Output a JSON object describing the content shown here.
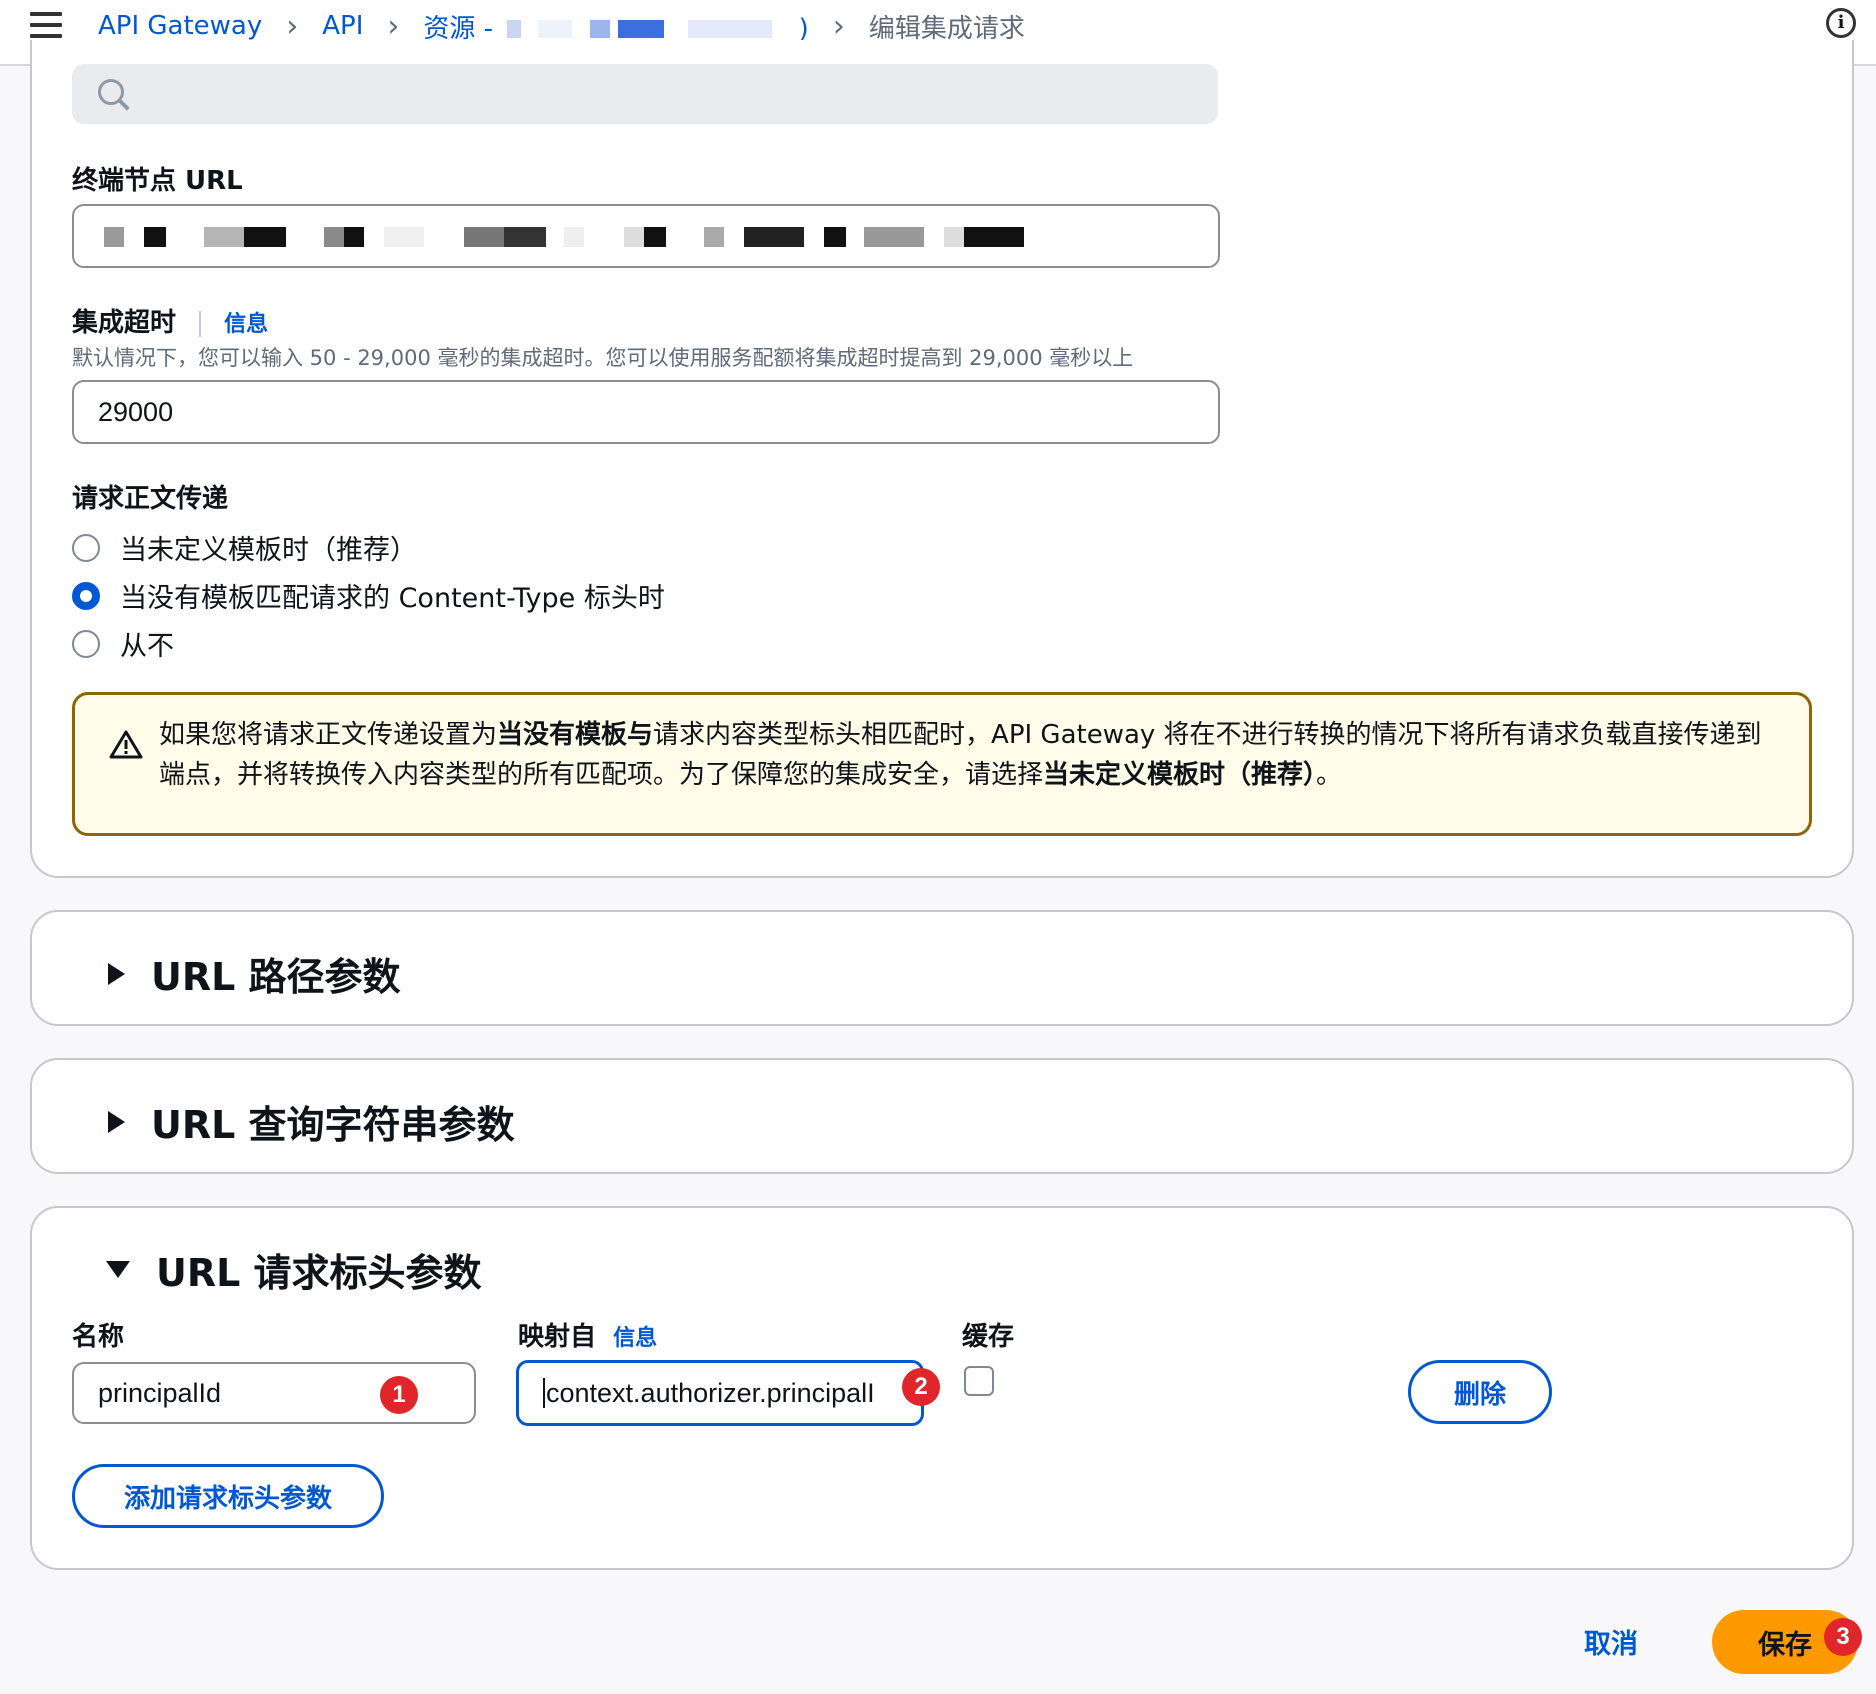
{
  "breadcrumbs": {
    "item1": "API Gateway",
    "item2": "API",
    "item3": "资源 -",
    "item3_suffix": ")",
    "current": "编辑集成请求"
  },
  "endpoint": {
    "label": "终端节点 URL"
  },
  "timeout": {
    "label": "集成超时",
    "info": "信息",
    "description": "默认情况下，您可以输入 50 - 29,000 毫秒的集成超时。您可以使用服务配额将集成超时提高到 29,000 毫秒以上",
    "value": "29000"
  },
  "passthrough": {
    "label": "请求正文传递",
    "options": [
      {
        "label": "当未定义模板时（推荐）",
        "checked": false
      },
      {
        "label": "当没有模板匹配请求的 Content-Type 标头时",
        "checked": true
      },
      {
        "label": "从不",
        "checked": false
      }
    ]
  },
  "alert": {
    "part1": "如果您将请求正文传递设置为",
    "bold1": "当没有模板与",
    "part2": "请求内容类型标头相匹配时，API Gateway 将在不进行转换的情况下将所有请求负载直接传递到端点，并将转换传入内容类型的所有匹配项。为了保障您的集成安全，请选择",
    "bold2": "当未定义模板时（推荐）",
    "part3": "。"
  },
  "sections": {
    "path_params": "URL 路径参数",
    "query_params": "URL 查询字符串参数",
    "header_params": "URL 请求标头参数"
  },
  "header_table": {
    "name_label": "名称",
    "mapped_label": "映射自",
    "mapped_info": "信息",
    "cache_label": "缓存",
    "rows": [
      {
        "name": "principalId",
        "mapped": "context.authorizer.principalI",
        "cached": false
      }
    ],
    "delete_label": "删除",
    "add_label": "添加请求标头参数"
  },
  "badges": [
    "1",
    "2",
    "3"
  ],
  "footer": {
    "cancel": "取消",
    "save": "保存"
  },
  "colors": {
    "accent": "#0058d2",
    "primary_button": "#ff9900",
    "warning_border": "#8d6605",
    "badge": "#e0262a"
  }
}
